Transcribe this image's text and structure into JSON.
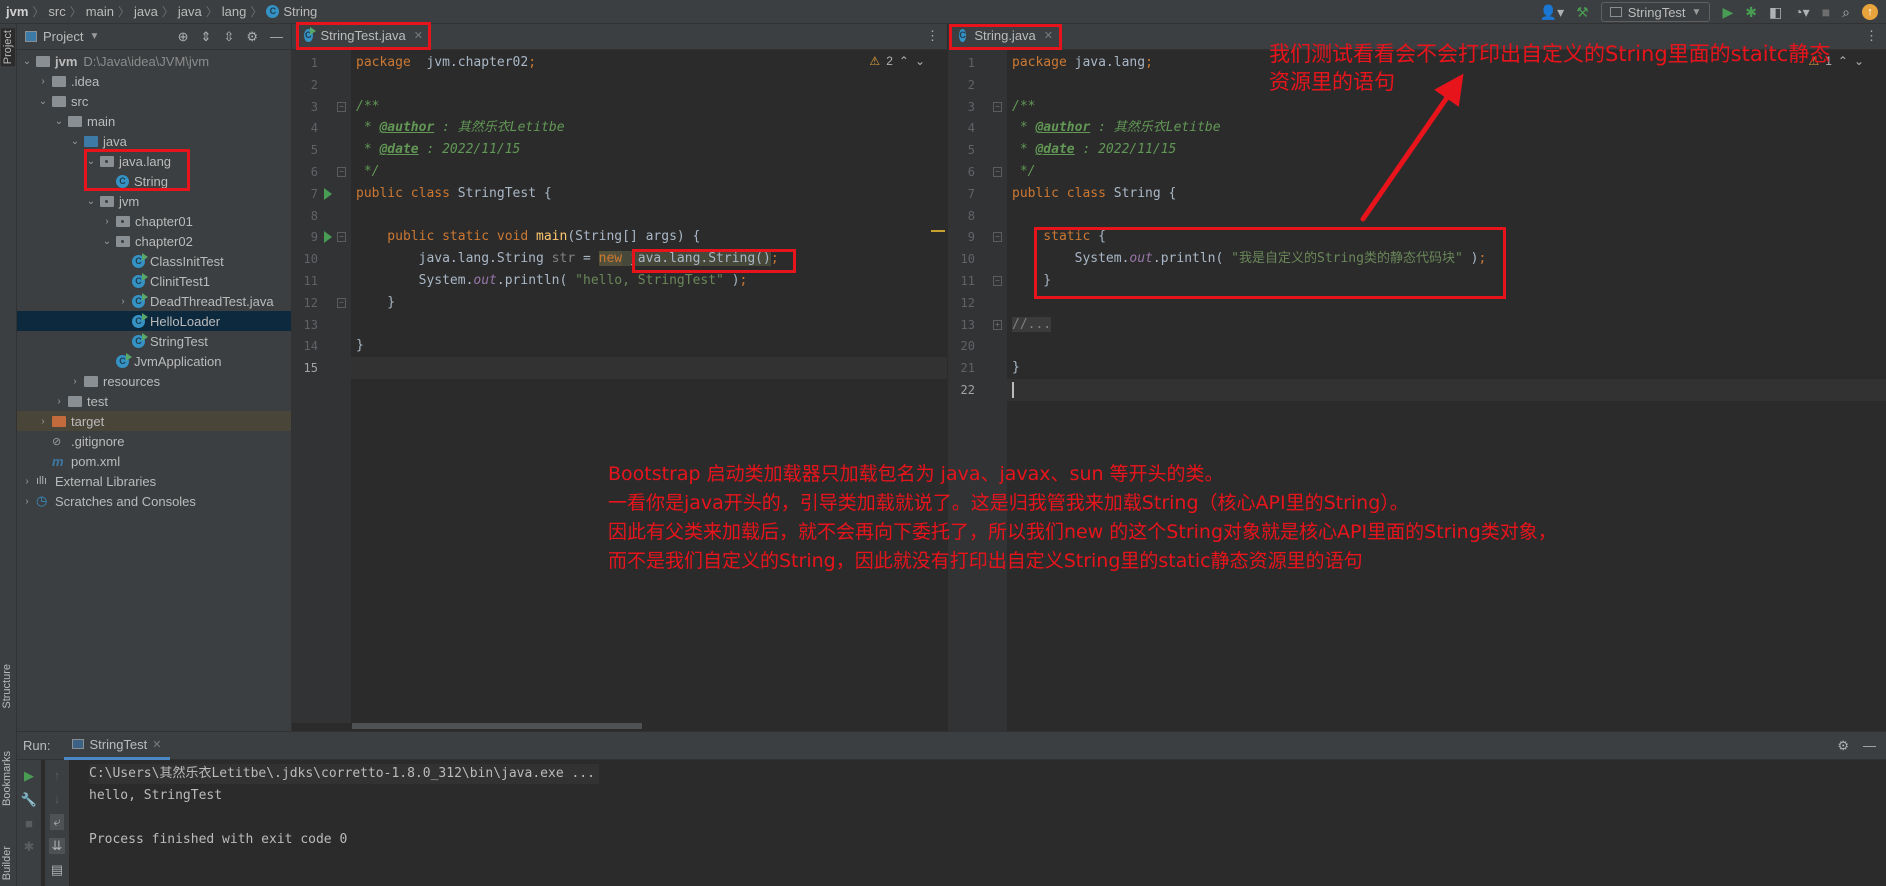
{
  "breadcrumb": [
    "jvm",
    "src",
    "main",
    "java",
    "java",
    "lang",
    "String"
  ],
  "toolbar": {
    "run_config": "StringTest",
    "icons": [
      "user-icon",
      "build-hammer-icon",
      "run-icon",
      "debug-icon",
      "coverage-icon",
      "profile-icon",
      "stop-icon",
      "search-icon",
      "update-icon"
    ]
  },
  "stripe": {
    "project": "Project",
    "structure": "Structure",
    "bookmarks": "Bookmarks",
    "builder": "Builder"
  },
  "project": {
    "title": "Project",
    "tree": [
      {
        "label": "jvm",
        "hint": "D:\\Java\\idea\\JVM\\jvm",
        "level": 0,
        "arrow": "open",
        "icon": "module"
      },
      {
        "label": ".idea",
        "level": 1,
        "arrow": "closed",
        "icon": "folder"
      },
      {
        "label": "src",
        "level": 1,
        "arrow": "open",
        "icon": "folder"
      },
      {
        "label": "main",
        "level": 2,
        "arrow": "open",
        "icon": "folder"
      },
      {
        "label": "java",
        "level": 3,
        "arrow": "open",
        "icon": "src"
      },
      {
        "label": "java.lang",
        "level": 4,
        "arrow": "open",
        "icon": "pkg"
      },
      {
        "label": "String",
        "level": 5,
        "arrow": "",
        "icon": "class"
      },
      {
        "label": "jvm",
        "level": 4,
        "arrow": "open",
        "icon": "pkg"
      },
      {
        "label": "chapter01",
        "level": 5,
        "arrow": "closed",
        "icon": "pkg"
      },
      {
        "label": "chapter02",
        "level": 5,
        "arrow": "open",
        "icon": "pkg"
      },
      {
        "label": "ClassInitTest",
        "level": 6,
        "arrow": "",
        "icon": "runclass"
      },
      {
        "label": "ClinitTest1",
        "level": 6,
        "arrow": "",
        "icon": "runclass"
      },
      {
        "label": "DeadThreadTest.java",
        "level": 6,
        "arrow": "closed",
        "icon": "runclass"
      },
      {
        "label": "HelloLoader",
        "level": 6,
        "arrow": "",
        "icon": "runclass",
        "selected": true
      },
      {
        "label": "StringTest",
        "level": 6,
        "arrow": "",
        "icon": "runclass"
      },
      {
        "label": "JvmApplication",
        "level": 5,
        "arrow": "",
        "icon": "runclass"
      },
      {
        "label": "resources",
        "level": 3,
        "arrow": "closed",
        "icon": "folder"
      },
      {
        "label": "test",
        "level": 2,
        "arrow": "closed",
        "icon": "folder"
      },
      {
        "label": "target",
        "level": 1,
        "arrow": "closed",
        "icon": "target",
        "excluded": true
      },
      {
        "label": ".gitignore",
        "level": 1,
        "arrow": "",
        "icon": "file"
      },
      {
        "label": "pom.xml",
        "level": 1,
        "arrow": "",
        "icon": "maven"
      },
      {
        "label": "External Libraries",
        "level": 0,
        "arrow": "closed",
        "icon": "library"
      },
      {
        "label": "Scratches and Consoles",
        "level": 0,
        "arrow": "closed",
        "icon": "scratch"
      }
    ]
  },
  "editor1": {
    "tab": "StringTest.java",
    "warnings": "2",
    "current_line": "15",
    "lines": [
      {
        "n": "1",
        "t": [
          [
            "kw",
            "package"
          ],
          [
            "",
            "  jvm.chapter02"
          ],
          [
            "kw",
            ";"
          ]
        ]
      },
      {
        "n": "2",
        "t": []
      },
      {
        "n": "3",
        "t": [
          [
            "doc",
            "/**"
          ]
        ]
      },
      {
        "n": "4",
        "t": [
          [
            "doc",
            " * "
          ],
          [
            "tag",
            "@author"
          ],
          [
            "doc",
            " : 其然乐衣Letitbe"
          ]
        ]
      },
      {
        "n": "5",
        "t": [
          [
            "doc",
            " * "
          ],
          [
            "tag",
            "@date"
          ],
          [
            "doc",
            " : 2022/11/15"
          ]
        ]
      },
      {
        "n": "6",
        "t": [
          [
            "doc",
            " */"
          ]
        ]
      },
      {
        "n": "7",
        "t": [
          [
            "kw",
            "public class "
          ],
          [
            "",
            "StringTest {"
          ]
        ]
      },
      {
        "n": "8",
        "t": []
      },
      {
        "n": "9",
        "t": [
          [
            "kw",
            "    public static void "
          ],
          [
            "meth",
            "main"
          ],
          [
            "",
            "(String[] args) {"
          ]
        ]
      },
      {
        "n": "10",
        "t": [
          [
            "",
            "        java.lang.String "
          ],
          [
            "unused",
            "str"
          ],
          [
            "",
            " = "
          ],
          [
            "hlnew",
            "new"
          ],
          [
            "hl",
            " java.lang.String()"
          ],
          [
            "kw",
            ";"
          ]
        ]
      },
      {
        "n": "11",
        "t": [
          [
            "",
            "        System."
          ],
          [
            "fld",
            "out"
          ],
          [
            "",
            ".println( "
          ],
          [
            "str",
            "\"hello, StringTest\""
          ],
          [
            "",
            " )"
          ],
          [
            "kw",
            ";"
          ]
        ]
      },
      {
        "n": "12",
        "t": [
          [
            "",
            "    }"
          ]
        ]
      },
      {
        "n": "13",
        "t": []
      },
      {
        "n": "14",
        "t": [
          [
            "",
            "}"
          ]
        ]
      },
      {
        "n": "15",
        "t": []
      }
    ]
  },
  "editor2": {
    "tab": "String.java",
    "warnings": "1",
    "current_line": "22",
    "lines": [
      {
        "n": "1",
        "t": [
          [
            "kw",
            "package"
          ],
          [
            "",
            " java.lang"
          ],
          [
            "kw",
            ";"
          ]
        ]
      },
      {
        "n": "2",
        "t": []
      },
      {
        "n": "3",
        "t": [
          [
            "doc",
            "/**"
          ]
        ]
      },
      {
        "n": "4",
        "t": [
          [
            "doc",
            " * "
          ],
          [
            "tag",
            "@author"
          ],
          [
            "doc",
            " : 其然乐衣Letitbe"
          ]
        ]
      },
      {
        "n": "5",
        "t": [
          [
            "doc",
            " * "
          ],
          [
            "tag",
            "@date"
          ],
          [
            "doc",
            " : 2022/11/15"
          ]
        ]
      },
      {
        "n": "6",
        "t": [
          [
            "doc",
            " */"
          ]
        ]
      },
      {
        "n": "7",
        "t": [
          [
            "kw",
            "public class "
          ],
          [
            "",
            "String {"
          ]
        ]
      },
      {
        "n": "8",
        "t": []
      },
      {
        "n": "9",
        "t": [
          [
            "kw",
            "    static "
          ],
          [
            "",
            "{"
          ]
        ]
      },
      {
        "n": "10",
        "t": [
          [
            "",
            "        System."
          ],
          [
            "fld",
            "out"
          ],
          [
            "",
            ".println( "
          ],
          [
            "str",
            "\"我是自定义的String类的静态代码块\""
          ],
          [
            "",
            " )"
          ],
          [
            "kw",
            ";"
          ]
        ]
      },
      {
        "n": "11",
        "t": [
          [
            "",
            "    }"
          ]
        ]
      },
      {
        "n": "12",
        "t": []
      },
      {
        "n": "13",
        "t": [
          [
            "fold",
            "//..."
          ]
        ]
      },
      {
        "n": "20",
        "t": []
      },
      {
        "n": "21",
        "t": [
          [
            "",
            "}"
          ]
        ]
      },
      {
        "n": "22",
        "t": []
      }
    ]
  },
  "run": {
    "label": "Run:",
    "tab": "StringTest",
    "console": [
      "C:\\Users\\其然乐衣Letitbe\\.jdks\\corretto-1.8.0_312\\bin\\java.exe ...",
      "hello, StringTest",
      "",
      "Process finished with exit code 0"
    ]
  },
  "annotations": {
    "top": [
      "我们测试看看会不会打印出自定义的String里面的staitc静态",
      "资源里的语句"
    ],
    "bottom": [
      "Bootstrap 启动类加载器只加载包名为 java、javax、sun 等开头的类。",
      "一看你是java开头的，引导类加载就说了。这是归我管我来加载String（核心API里的String）。",
      "因此有父类来加载后，就不会再向下委托了，所以我们new 的这个String对象就是核心API里面的String类对象，",
      "而不是我们自定义的String，因此就没有打印出自定义String里的static静态资源里的语句"
    ],
    "color": "#e8141c"
  }
}
